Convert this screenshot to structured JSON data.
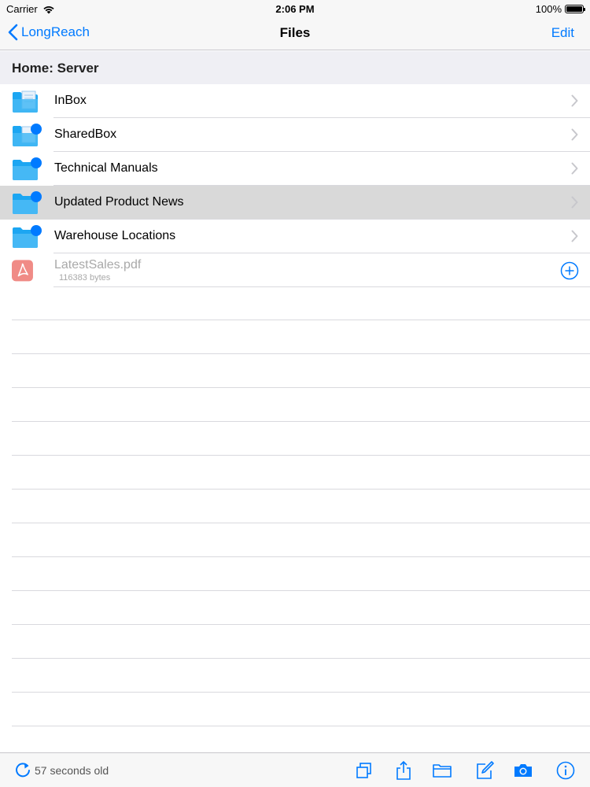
{
  "status_bar": {
    "carrier": "Carrier",
    "time": "2:06 PM",
    "battery": "100%"
  },
  "nav": {
    "back_label": "LongReach",
    "title": "Files",
    "edit_label": "Edit"
  },
  "section": {
    "title": "Home: Server"
  },
  "folders": [
    {
      "name": "InBox",
      "icon": "inbox-folder-icon",
      "badge": false,
      "selected": false
    },
    {
      "name": "SharedBox",
      "icon": "shared-folder-icon",
      "badge": true,
      "selected": false
    },
    {
      "name": "Technical Manuals",
      "icon": "folder-icon",
      "badge": true,
      "selected": false
    },
    {
      "name": "Updated Product News",
      "icon": "folder-icon",
      "badge": true,
      "selected": true
    },
    {
      "name": "Warehouse Locations",
      "icon": "folder-icon",
      "badge": true,
      "selected": false
    }
  ],
  "file": {
    "name": "LatestSales.pdf",
    "size": "116383 bytes",
    "icon": "pdf-icon"
  },
  "toolbar": {
    "refresh_status": "57 seconds old"
  },
  "colors": {
    "accent": "#007aff",
    "folder": "#1ca6f2",
    "pdf": "#f08b86",
    "selected_row": "#d9d9d9"
  }
}
